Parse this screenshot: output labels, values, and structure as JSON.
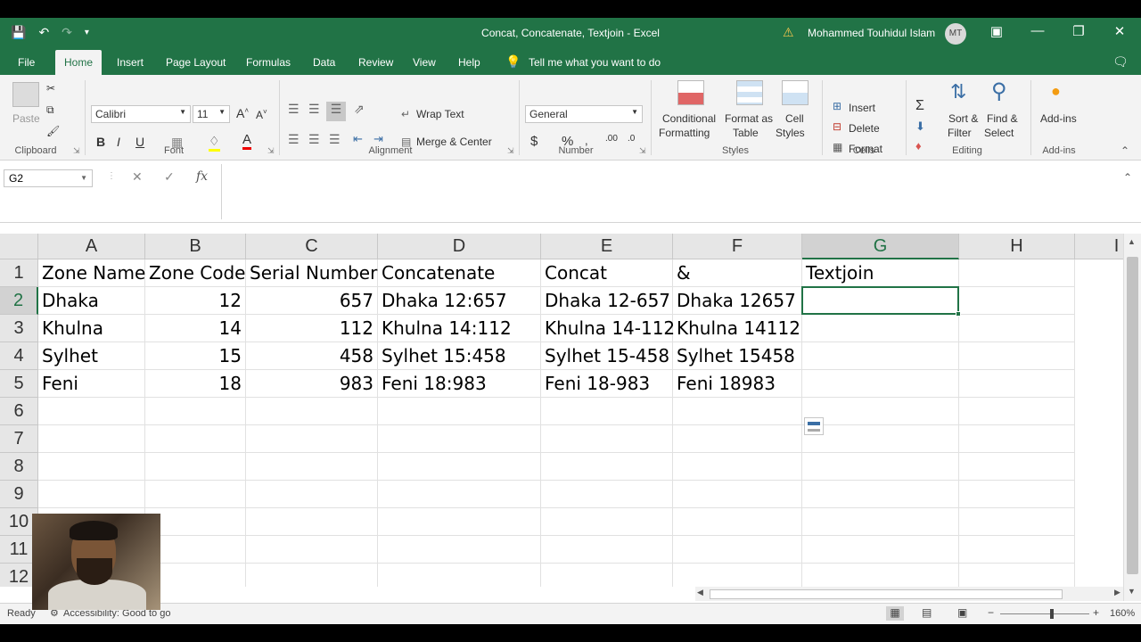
{
  "window": {
    "title": "Concat, Concatenate, Textjoin  -  Excel",
    "user": "Mohammed Touhidul Islam",
    "user_initials": "MT"
  },
  "tabs": [
    {
      "label": "File"
    },
    {
      "label": "Home"
    },
    {
      "label": "Insert"
    },
    {
      "label": "Page Layout"
    },
    {
      "label": "Formulas"
    },
    {
      "label": "Data"
    },
    {
      "label": "Review"
    },
    {
      "label": "View"
    },
    {
      "label": "Help"
    }
  ],
  "tell_me": "Tell me what you want to do",
  "ribbon": {
    "clipboard": {
      "paste": "Paste",
      "label": "Clipboard"
    },
    "font": {
      "name": "Calibri",
      "size": "11",
      "label": "Font",
      "bold": "B",
      "italic": "I",
      "underline": "U"
    },
    "alignment": {
      "wrap": "Wrap Text",
      "merge": "Merge & Center",
      "label": "Alignment"
    },
    "number": {
      "format": "General",
      "label": "Number",
      "currency": "$",
      "percent": "%"
    },
    "styles": {
      "conditional": "Conditional",
      "conditional2": "Formatting",
      "format_as": "Format as",
      "format_as2": "Table",
      "cell": "Cell",
      "cell2": "Styles",
      "label": "Styles"
    },
    "cells": {
      "insert": "Insert",
      "delete": "Delete",
      "format": "Format",
      "label": "Cells"
    },
    "editing": {
      "sort": "Sort &",
      "sort2": "Filter",
      "find": "Find &",
      "find2": "Select",
      "label": "Editing"
    },
    "addins": {
      "addins": "Add-ins",
      "label": "Add-ins"
    }
  },
  "formula_bar": {
    "name_box": "G2",
    "value": ""
  },
  "columns": [
    "A",
    "B",
    "C",
    "D",
    "E",
    "F",
    "G",
    "H",
    "I"
  ],
  "rows": [
    "1",
    "2",
    "3",
    "4",
    "5",
    "6",
    "7",
    "8",
    "9",
    "10",
    "11",
    "12"
  ],
  "cells": [
    [
      "Zone Name",
      "Zone Code",
      "Serial Number",
      "Concatenate",
      "Concat",
      "&",
      "Textjoin"
    ],
    [
      "Dhaka",
      "12",
      "657",
      "Dhaka 12:657",
      "Dhaka 12-657",
      "Dhaka 12657",
      ""
    ],
    [
      "Khulna",
      "14",
      "112",
      "Khulna 14:112",
      "Khulna 14-112",
      "Khulna 14112",
      ""
    ],
    [
      "Sylhet",
      "15",
      "458",
      "Sylhet 15:458",
      "Sylhet 15-458",
      "Sylhet 15458",
      ""
    ],
    [
      "Feni",
      "18",
      "983",
      "Feni 18:983",
      "Feni 18-983",
      "Feni 18983",
      ""
    ]
  ],
  "selected_cell": "G2",
  "status": {
    "ready": "Ready",
    "accessibility": "Accessibility: Good to go",
    "zoom": "160%"
  }
}
